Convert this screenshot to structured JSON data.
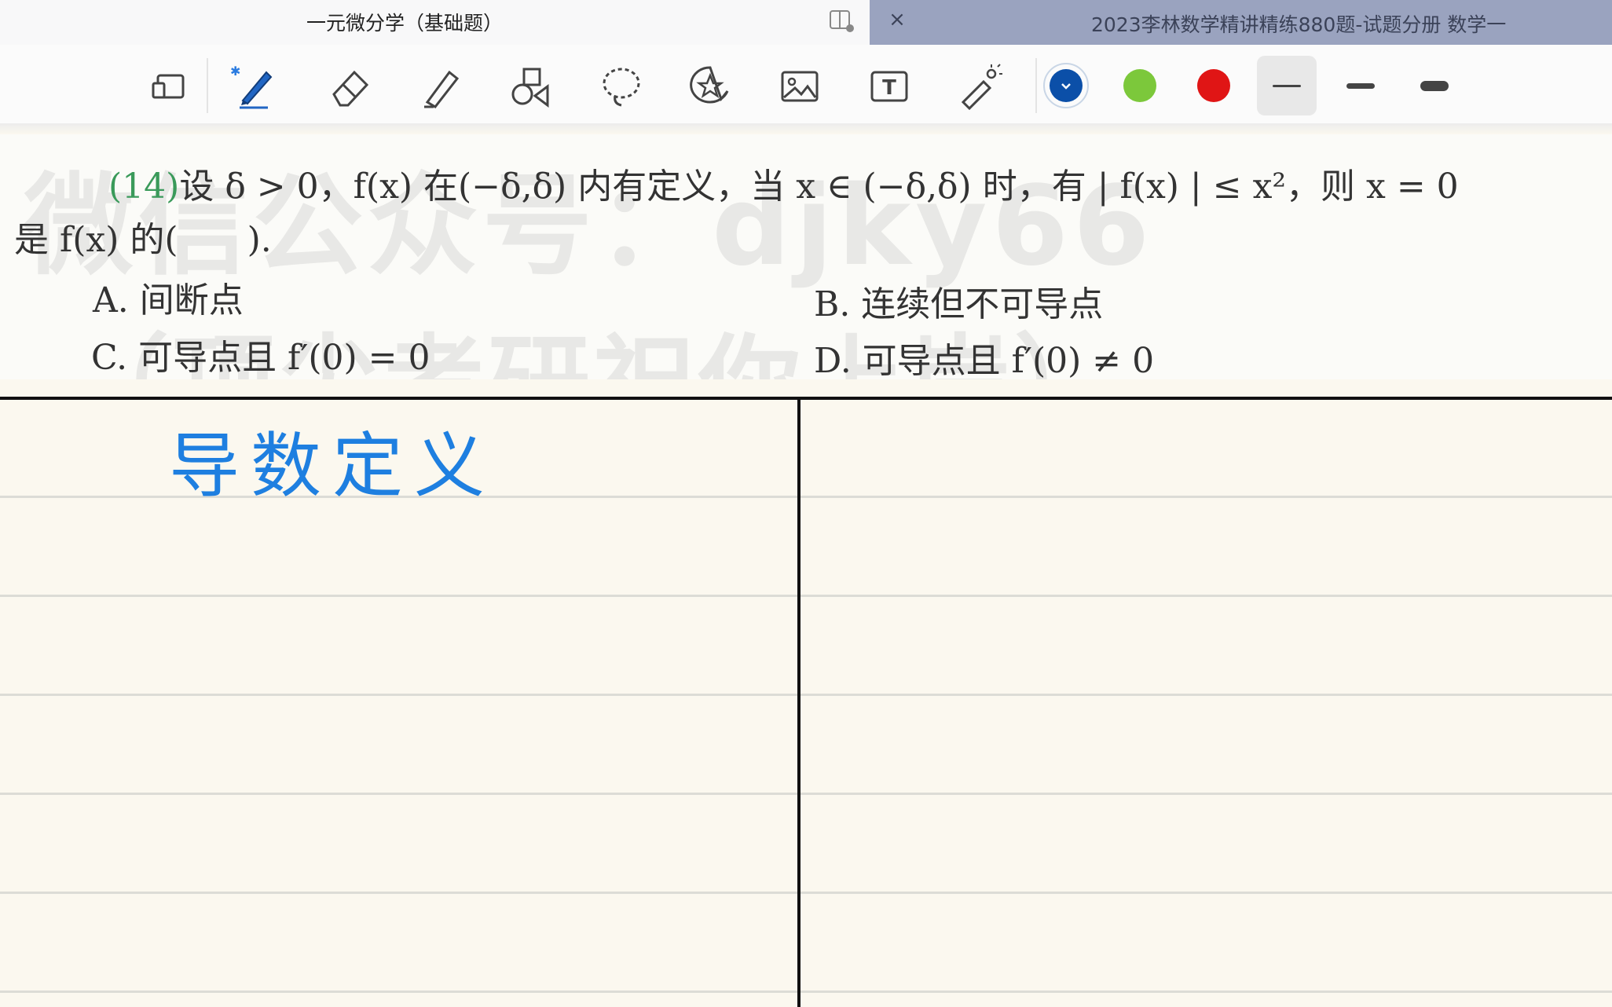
{
  "tabs": {
    "active_title": "一元微分学（基础题）",
    "inactive_title": "2023李林数学精讲精练880题-试题分册 数学一",
    "close_glyph": "×"
  },
  "toolbar": {
    "tools": [
      "page-view",
      "pen",
      "eraser",
      "highlighter",
      "shapes",
      "lasso",
      "sticker",
      "image",
      "text",
      "laser-pointer"
    ],
    "colors": [
      "#0b4fa8",
      "#7cc83b",
      "#e01515"
    ],
    "selected_color_index": 0,
    "selected_stroke_index": 0
  },
  "problem": {
    "number": "(14)",
    "line1": "设 δ > 0，f(x) 在(−δ,δ) 内有定义，当 x ∈ (−δ,δ) 时，有 | f(x) | ≤ x²，则 x = 0",
    "line2": "是 f(x) 的(　　).",
    "options": {
      "a": "A. 间断点",
      "b": "B. 连续但不可导点",
      "c": "C. 可导点且 f′(0) = 0",
      "d": "D. 可导点且 f′(0) ≠ 0"
    },
    "watermark_line1": "微信公众号：djky66",
    "watermark_line2": "（顶尖考研祝你上岸）"
  },
  "notes": {
    "handwriting": "导数定义"
  }
}
